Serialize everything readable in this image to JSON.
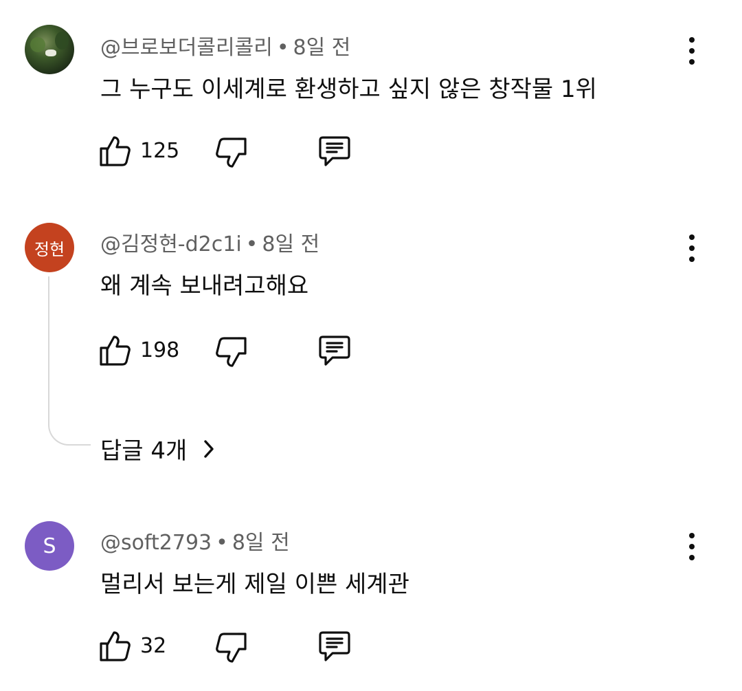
{
  "comments": [
    {
      "author": "@브로보더콜리콜리",
      "time": "8일 전",
      "text": "그 누구도 이세계로 환생하고 싶지 않은 창작물 1위",
      "likes": "125",
      "avatar": {
        "type": "photo",
        "initials": ""
      }
    },
    {
      "author": "@김정현-d2c1i",
      "time": "8일 전",
      "text": "왜 계속 보내려고해요",
      "likes": "198",
      "avatar": {
        "type": "initials",
        "initials": "정현",
        "color": "#c4421f"
      },
      "replies_label": "답글 4개"
    },
    {
      "author": "@soft2793",
      "time": "8일 전",
      "text": "멀리서 보는게 제일 이쁜 세계관",
      "likes": "32",
      "avatar": {
        "type": "initials",
        "initials": "S",
        "color": "#7c5cc4"
      }
    }
  ],
  "separator": "•",
  "icons": {
    "like": "thumb-up-icon",
    "dislike": "thumb-down-icon",
    "reply": "comment-reply-icon",
    "more": "more-vertical-icon",
    "chevron": "chevron-right-icon"
  }
}
